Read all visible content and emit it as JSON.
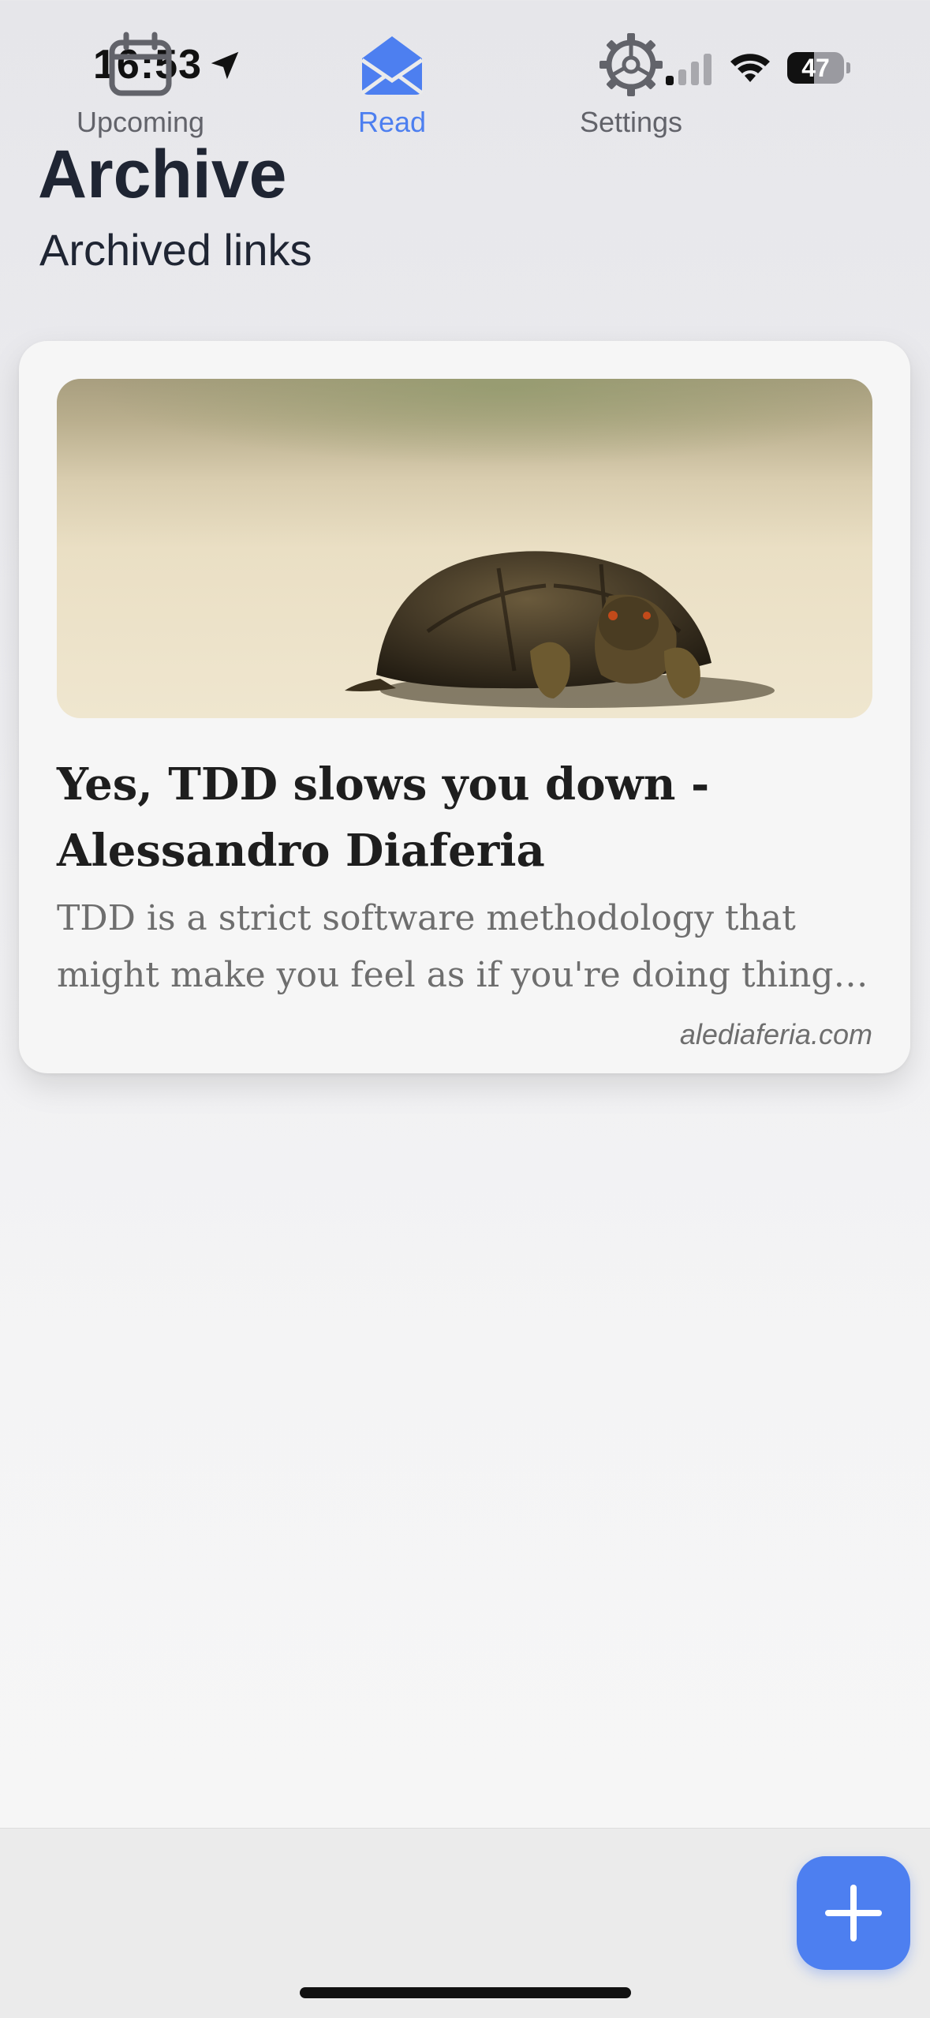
{
  "status_bar": {
    "time": "16:53",
    "battery_percent": "47",
    "battery_level": 0.47,
    "signal_bars_active": 1,
    "signal_bars_total": 4
  },
  "header": {
    "title": "Archive",
    "subtitle": "Archived links"
  },
  "card": {
    "title": "Yes, TDD slows you down - Alessandro Diaferia",
    "description": "TDD is a strict software methodology that might make you feel as if you're doing things slower than you normally would.",
    "domain": "alediaferia.com",
    "image_icon": "turtle-photo"
  },
  "tabs": [
    {
      "label": "Upcoming",
      "icon": "calendar-icon",
      "active": false
    },
    {
      "label": "Read",
      "icon": "open-envelope-icon",
      "active": true
    },
    {
      "label": "Settings",
      "icon": "gear-icon",
      "active": false
    }
  ],
  "fab": {
    "icon": "plus-icon"
  },
  "colors": {
    "accent": "#4d7ff0",
    "title_text": "#1f2533",
    "muted_text": "#6e6e6e",
    "tab_inactive": "#62636a"
  }
}
